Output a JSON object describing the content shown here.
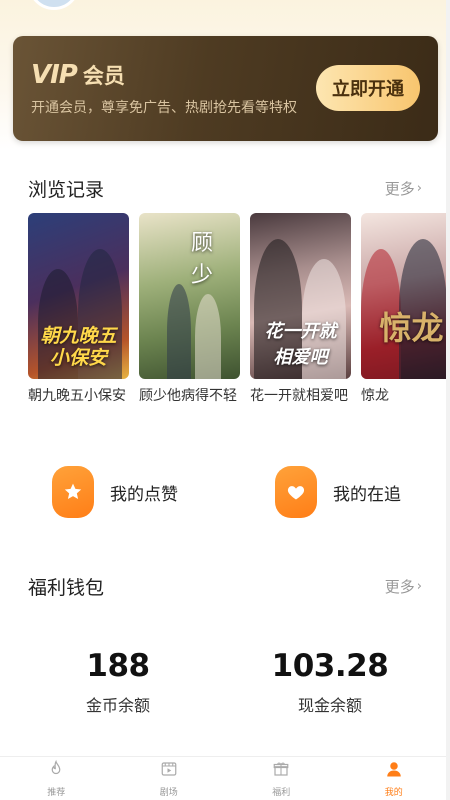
{
  "vip": {
    "logo": "VIP",
    "title": "会员",
    "description": "开通会员，尊享免广告、热剧抢先看等特权",
    "cta": "立即开通"
  },
  "history": {
    "title": "浏览记录",
    "more": "更多",
    "items": [
      {
        "caption": "朝九晚五小保安",
        "poster_text": "朝九晚五小保安"
      },
      {
        "caption": "顾少他病得不轻",
        "poster_text": "顾少"
      },
      {
        "caption": "花一开就相爱吧",
        "poster_text": "花一开就相爱吧"
      },
      {
        "caption": "惊龙",
        "poster_text": "惊龙"
      }
    ]
  },
  "actions": {
    "likes": "我的点赞",
    "following": "我的在追"
  },
  "wallet": {
    "title": "福利钱包",
    "more": "更多",
    "coins_value": "188",
    "coins_label": "金币余额",
    "cash_value": "103.28",
    "cash_label": "现金余额"
  },
  "tabbar": {
    "items": [
      {
        "label": "推荐",
        "icon": "flame-icon"
      },
      {
        "label": "剧场",
        "icon": "film-icon"
      },
      {
        "label": "福利",
        "icon": "gift-icon"
      },
      {
        "label": "我的",
        "icon": "user-icon",
        "active": true
      }
    ]
  },
  "colors": {
    "accent": "#ff7e17",
    "vip_gold": "#f8c56e"
  }
}
